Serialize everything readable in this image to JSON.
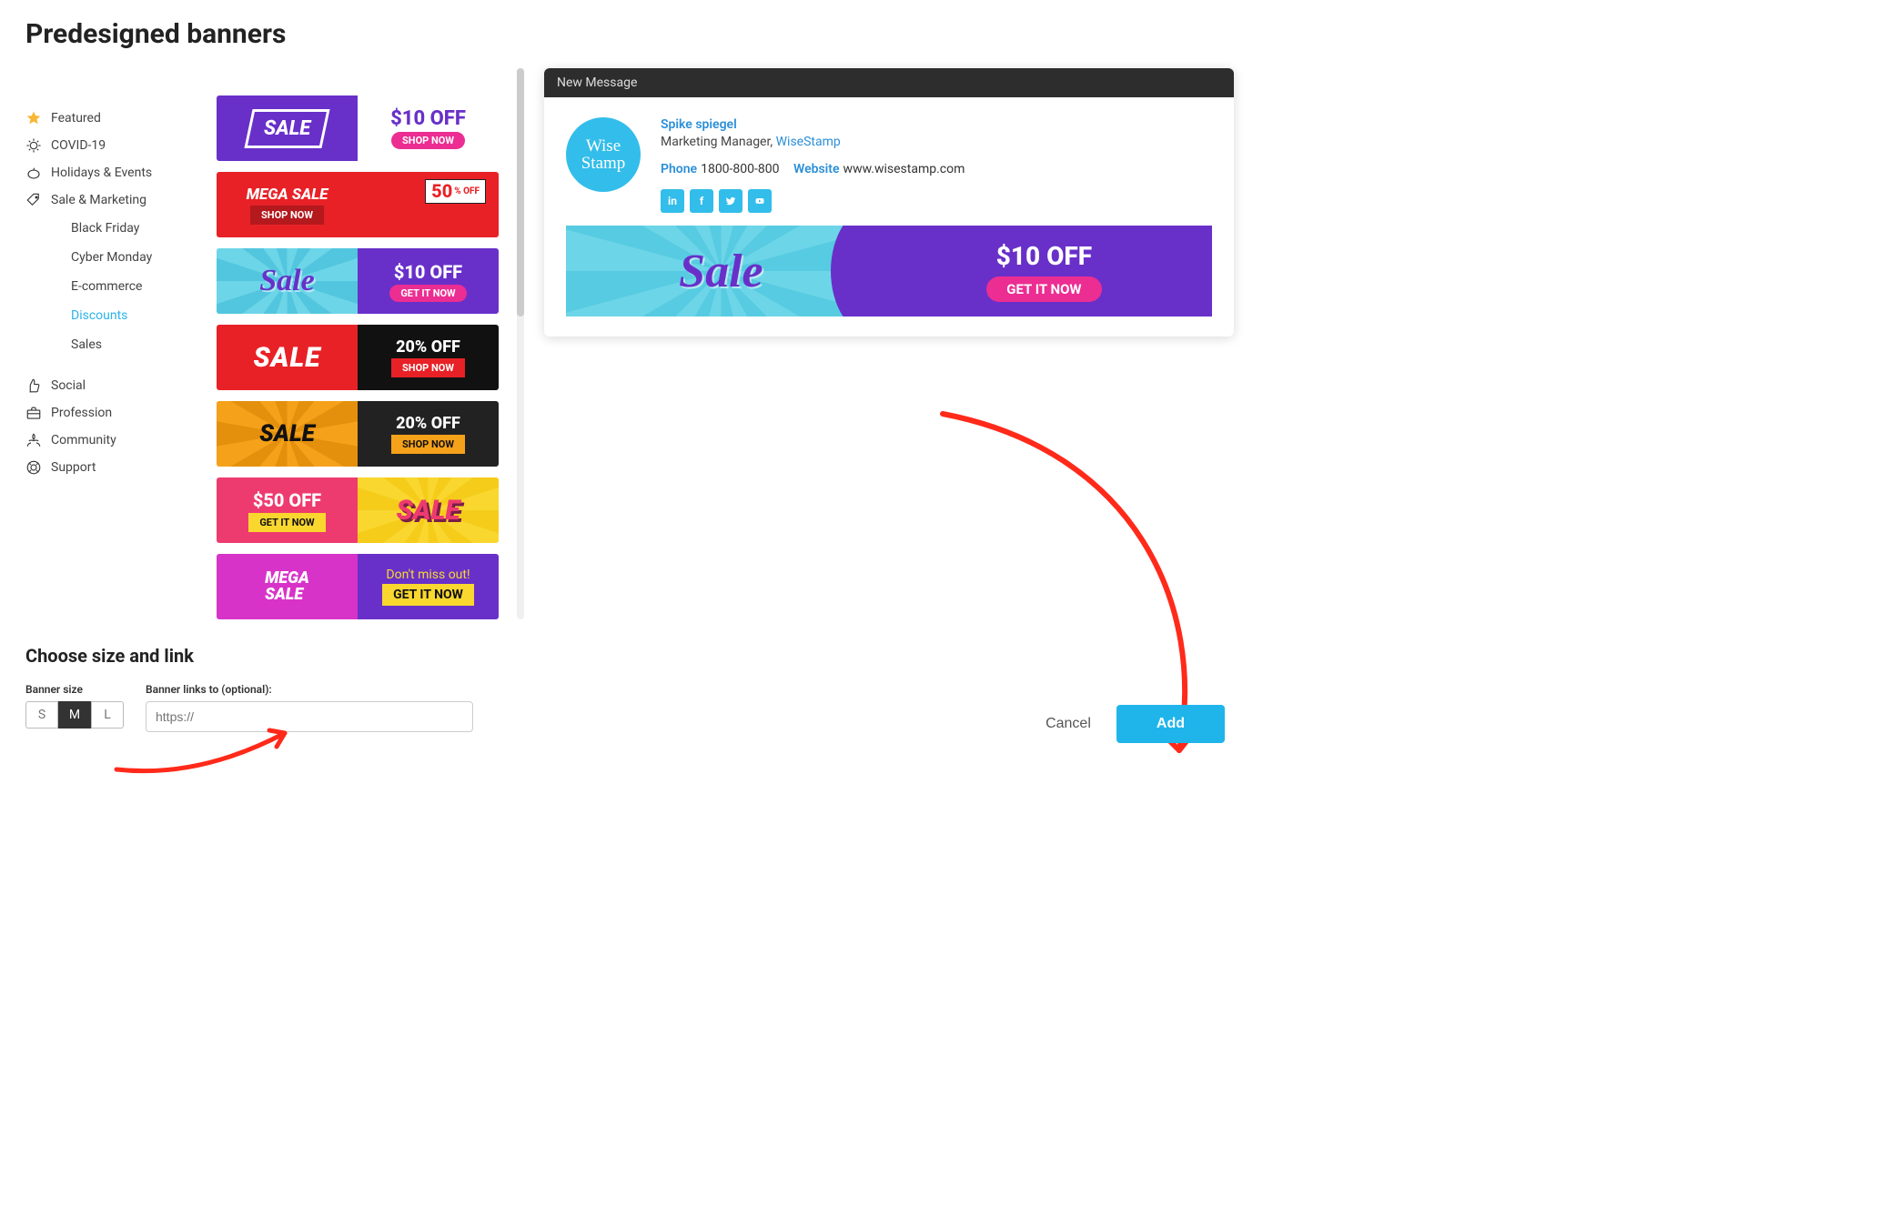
{
  "page_title": "Predesigned banners",
  "categories": [
    {
      "id": "featured",
      "label": "Featured",
      "icon": "star"
    },
    {
      "id": "covid",
      "label": "COVID-19",
      "icon": "virus"
    },
    {
      "id": "holidays",
      "label": "Holidays & Events",
      "icon": "pumpkin"
    },
    {
      "id": "sale",
      "label": "Sale & Marketing",
      "icon": "tag",
      "sub": [
        {
          "id": "black-friday",
          "label": "Black Friday"
        },
        {
          "id": "cyber-monday",
          "label": "Cyber Monday"
        },
        {
          "id": "ecommerce",
          "label": "E-commerce"
        },
        {
          "id": "discounts",
          "label": "Discounts",
          "active": true
        },
        {
          "id": "sales",
          "label": "Sales"
        }
      ]
    },
    {
      "id": "social",
      "label": "Social",
      "icon": "thumb"
    },
    {
      "id": "profession",
      "label": "Profession",
      "icon": "briefcase"
    },
    {
      "id": "community",
      "label": "Community",
      "icon": "community"
    },
    {
      "id": "support",
      "label": "Support",
      "icon": "lifebuoy"
    }
  ],
  "banners": {
    "b1": {
      "main": "SALE",
      "price": "$10 OFF",
      "cta": "SHOP NOW"
    },
    "b2": {
      "main": "MEGA SALE",
      "cta": "SHOP NOW",
      "pct": "50",
      "pct_unit": "% OFF"
    },
    "b3": {
      "main": "Sale",
      "price": "$10 OFF",
      "cta": "GET IT NOW"
    },
    "b4": {
      "main": "SALE",
      "price": "20% OFF",
      "cta": "SHOP NOW"
    },
    "b5": {
      "main": "SALE",
      "price": "20% OFF",
      "cta": "SHOP NOW"
    },
    "b6": {
      "price": "$50 OFF",
      "cta": "GET IT NOW",
      "main": "SALE"
    },
    "b7": {
      "main1": "MEGA",
      "main2": "SALE",
      "tag": "Don't miss out!",
      "cta": "GET IT NOW"
    }
  },
  "choose": {
    "heading": "Choose size and link",
    "size_label": "Banner size",
    "sizes": [
      "S",
      "M",
      "L"
    ],
    "selected_size": "M",
    "link_label": "Banner links to (optional):",
    "link_placeholder": "https://"
  },
  "preview": {
    "header": "New Message",
    "avatar_text": "Wise Stamp",
    "name": "Spike spiegel",
    "title": "Marketing Manager, ",
    "company": "WiseStamp",
    "phone_label": "Phone",
    "phone": "1800-800-800",
    "website_label": "Website",
    "website": "www.wisestamp.com",
    "social": [
      "in",
      "f",
      "t",
      "yt"
    ],
    "banner": {
      "main": "Sale",
      "price": "$10 OFF",
      "cta": "GET IT NOW"
    }
  },
  "footer": {
    "cancel": "Cancel",
    "add": "Add"
  }
}
